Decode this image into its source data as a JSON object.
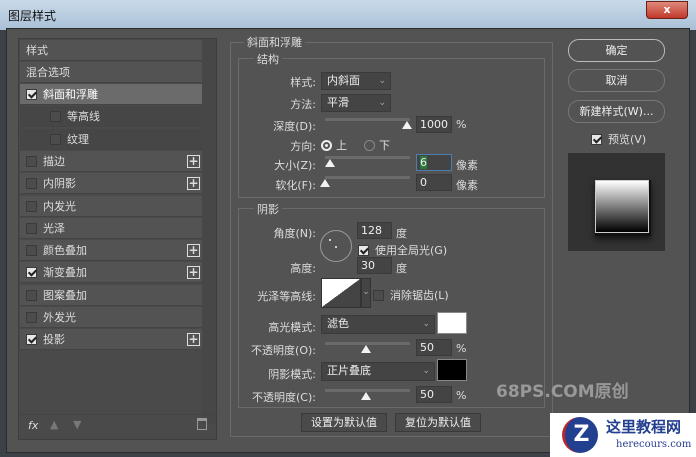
{
  "window": {
    "title": "图层样式",
    "close_label": "x"
  },
  "sidebar": {
    "header": "样式",
    "blend_options": "混合选项",
    "items": [
      {
        "label": "斜面和浮雕",
        "checked": true,
        "selected": true
      },
      {
        "label": "等高线",
        "checked": false,
        "sub": true
      },
      {
        "label": "纹理",
        "checked": false,
        "sub": true
      },
      {
        "label": "描边",
        "checked": false,
        "plus": true
      },
      {
        "label": "内阴影",
        "checked": false,
        "plus": true
      },
      {
        "label": "内发光",
        "checked": false
      },
      {
        "label": "光泽",
        "checked": false
      },
      {
        "label": "颜色叠加",
        "checked": false,
        "plus": true
      },
      {
        "label": "渐变叠加",
        "checked": true,
        "plus": true
      },
      {
        "label": "图案叠加",
        "checked": false
      },
      {
        "label": "外发光",
        "checked": false
      },
      {
        "label": "投影",
        "checked": true,
        "plus": true
      }
    ],
    "fx_label": "fx"
  },
  "bevel": {
    "title": "斜面和浮雕",
    "structure": {
      "title": "结构",
      "style_label": "样式:",
      "style_value": "内斜面",
      "technique_label": "方法:",
      "technique_value": "平滑",
      "depth_label": "深度(D):",
      "depth_value": "1000",
      "depth_unit": "%",
      "direction_label": "方向:",
      "dir_up": "上",
      "dir_down": "下",
      "size_label": "大小(Z):",
      "size_value": "6",
      "size_unit": "像素",
      "soften_label": "软化(F):",
      "soften_value": "0",
      "soften_unit": "像素"
    },
    "shading": {
      "title": "阴影",
      "angle_label": "角度(N):",
      "angle_value": "128",
      "angle_unit": "度",
      "global_light_label": "使用全局光(G)",
      "altitude_label": "高度:",
      "altitude_value": "30",
      "altitude_unit": "度",
      "gloss_label": "光泽等高线:",
      "antialias_label": "消除锯齿(L)",
      "highlight_label": "高光模式:",
      "highlight_mode": "滤色",
      "highlight_color": "#ffffff",
      "hl_opacity_label": "不透明度(O):",
      "hl_opacity_value": "50",
      "hl_opacity_unit": "%",
      "shadow_label": "阴影模式:",
      "shadow_mode": "正片叠底",
      "shadow_color": "#000000",
      "sh_opacity_label": "不透明度(C):",
      "sh_opacity_value": "50",
      "sh_opacity_unit": "%"
    },
    "make_default": "设置为默认值",
    "reset_default": "复位为默认值"
  },
  "actions": {
    "ok": "确定",
    "cancel": "取消",
    "new_style": "新建样式(W)...",
    "preview_label": "预览(V)"
  },
  "watermark": {
    "text1": "68PS.COM原创",
    "text2": "这里教程网",
    "text3": "herecours.com"
  }
}
